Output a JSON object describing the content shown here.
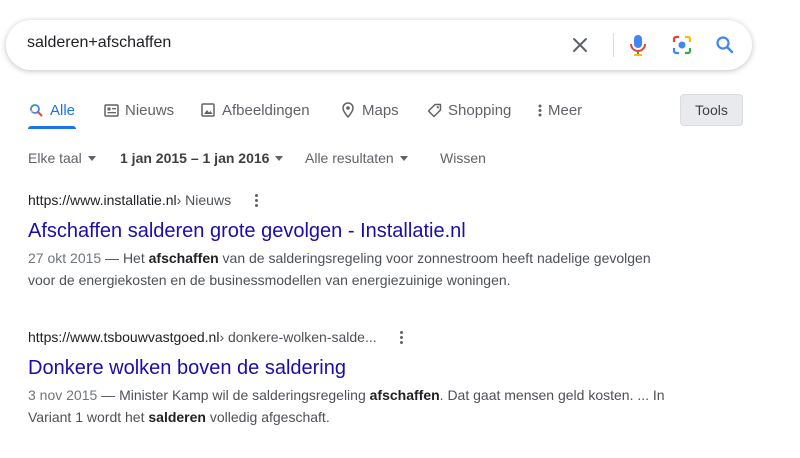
{
  "search": {
    "query": "salderen+afschaffen"
  },
  "tabs": [
    {
      "label": "Alle",
      "icon": "search-icon",
      "active": true
    },
    {
      "label": "Nieuws",
      "icon": "news-icon"
    },
    {
      "label": "Afbeeldingen",
      "icon": "image-icon"
    },
    {
      "label": "Maps",
      "icon": "map-pin-icon"
    },
    {
      "label": "Shopping",
      "icon": "tag-icon"
    },
    {
      "label": "Meer",
      "icon": "more-vert-icon"
    }
  ],
  "tools_label": "Tools",
  "filters": {
    "language": "Elke taal",
    "date_range": "1 jan 2015 – 1 jan 2016",
    "results": "Alle resultaten",
    "clear": "Wissen"
  },
  "results": [
    {
      "url": "https://www.installatie.nl",
      "breadcrumb": " › Nieuws",
      "title": "Afschaffen salderen grote gevolgen - Installatie.nl",
      "date": "27 okt 2015",
      "snippet_parts": [
        {
          "text": " — Het ",
          "bold": false
        },
        {
          "text": "afschaffen",
          "bold": true
        },
        {
          "text": " van de salderingsregeling voor zonnestroom heeft nadelige gevolgen voor de energiekosten en de businessmodellen van energiezuinige woningen.",
          "bold": false
        }
      ]
    },
    {
      "url": "https://www.tsbouwvastgoed.nl",
      "breadcrumb": " › donkere-wolken-salde...",
      "title": "Donkere wolken boven de saldering",
      "date": "3 nov 2015",
      "snippet_parts": [
        {
          "text": " — Minister Kamp wil de salderingsregeling ",
          "bold": false
        },
        {
          "text": "afschaffen",
          "bold": true
        },
        {
          "text": ". Dat gaat mensen geld kosten. ... In Variant 1 wordt het ",
          "bold": false
        },
        {
          "text": "salderen",
          "bold": true
        },
        {
          "text": " volledig afgeschaft.",
          "bold": false
        }
      ]
    }
  ],
  "colors": {
    "link": "#1a0dab",
    "accent": "#1a73e8",
    "text_secondary": "#4d5156"
  }
}
